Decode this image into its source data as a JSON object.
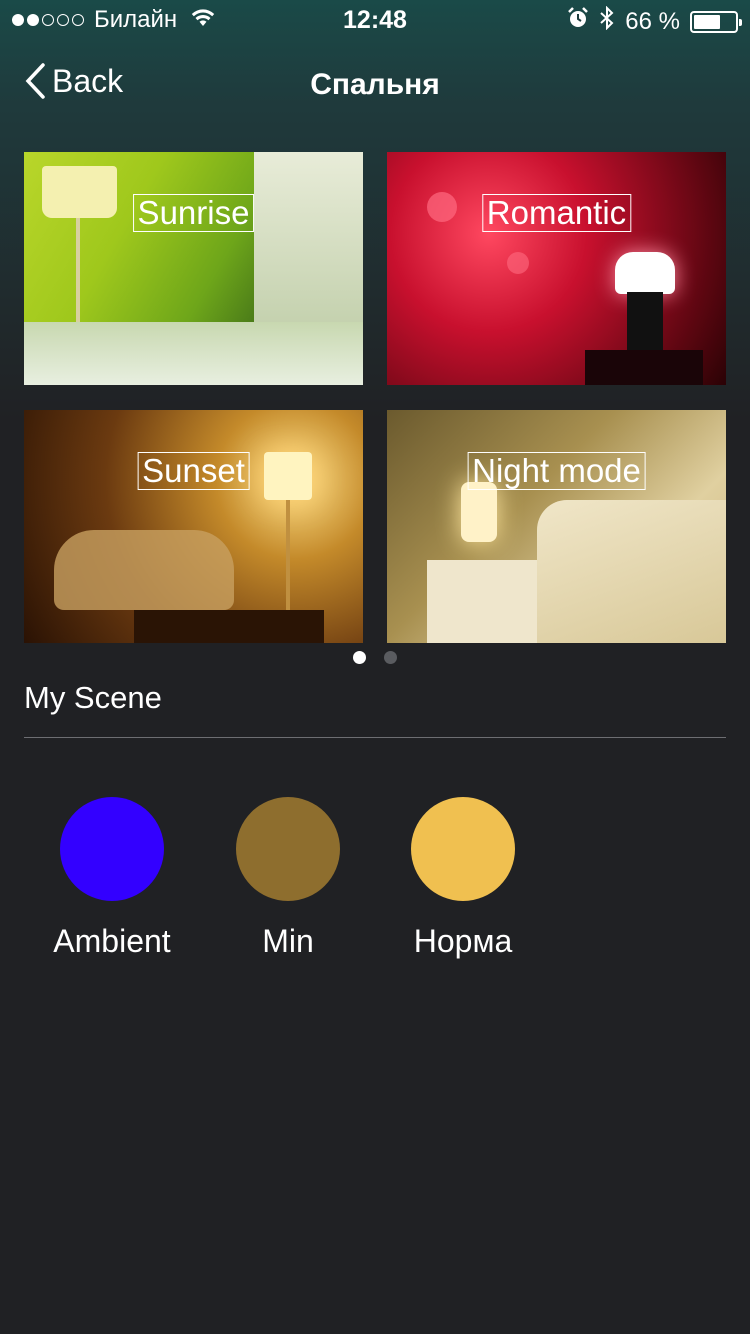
{
  "status_bar": {
    "carrier": "Билайн",
    "time": "12:48",
    "battery_text": "66 %",
    "battery_level": 0.66,
    "signal_bars_filled": 2,
    "signal_bars_total": 5
  },
  "nav": {
    "back_label": "Back",
    "title": "Спальня"
  },
  "scenes_grid": {
    "tiles": [
      {
        "label": "Sunrise",
        "color": "#9fc81c"
      },
      {
        "label": "Romantic",
        "color": "#c8102e"
      },
      {
        "label": "Sunset",
        "color": "#c48a2a"
      },
      {
        "label": "Night mode",
        "color": "#c8b17a"
      }
    ],
    "page_index": 1,
    "page_count": 2
  },
  "my_scene": {
    "title": "My Scene",
    "items": [
      {
        "label": "Ambient",
        "color": "#3300ff"
      },
      {
        "label": "Min",
        "color": "#8e6e2e"
      },
      {
        "label": "Норма",
        "color": "#f0c050"
      }
    ]
  }
}
